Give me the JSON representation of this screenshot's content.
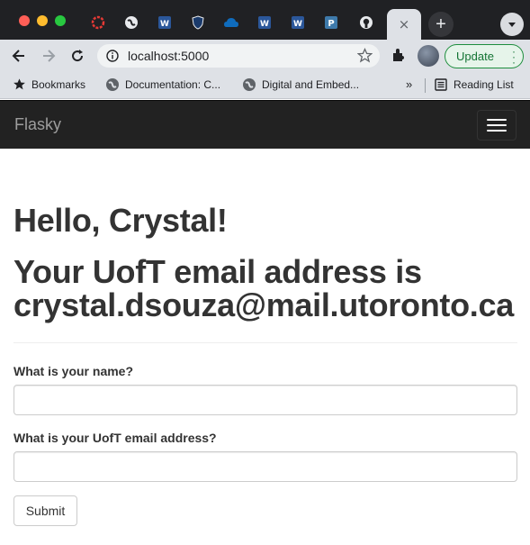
{
  "browser": {
    "tabs": [
      {
        "icon": "red-ring-icon"
      },
      {
        "icon": "globe-icon"
      },
      {
        "icon": "word-icon"
      },
      {
        "icon": "shield-icon"
      },
      {
        "icon": "onedrive-icon"
      },
      {
        "icon": "word-icon"
      },
      {
        "icon": "word-icon"
      },
      {
        "icon": "piazza-icon"
      },
      {
        "icon": "github-icon"
      }
    ],
    "active_tab_close": "×",
    "new_tab": "+",
    "address_url": "localhost:5000",
    "update_label": "Update",
    "bookmarks": [
      {
        "label": "Bookmarks",
        "icon": "star-icon"
      },
      {
        "label": "Documentation: C...",
        "icon": "globe-icon"
      },
      {
        "label": "Digital and Embed...",
        "icon": "globe-icon"
      }
    ],
    "bookmarks_more": "»",
    "reading_list_label": "Reading List",
    "colors": {
      "accent_green": "#137333",
      "navbar_bg": "#222222"
    }
  },
  "navbar": {
    "brand": "Flasky"
  },
  "page": {
    "greeting": "Hello, Crystal!",
    "email_heading": "Your UofT email address is crystal.dsouza@mail.utoronto.ca",
    "form": {
      "name_label": "What is your name?",
      "name_value": "",
      "email_label": "What is your UofT email address?",
      "email_value": "",
      "submit_label": "Submit"
    }
  }
}
